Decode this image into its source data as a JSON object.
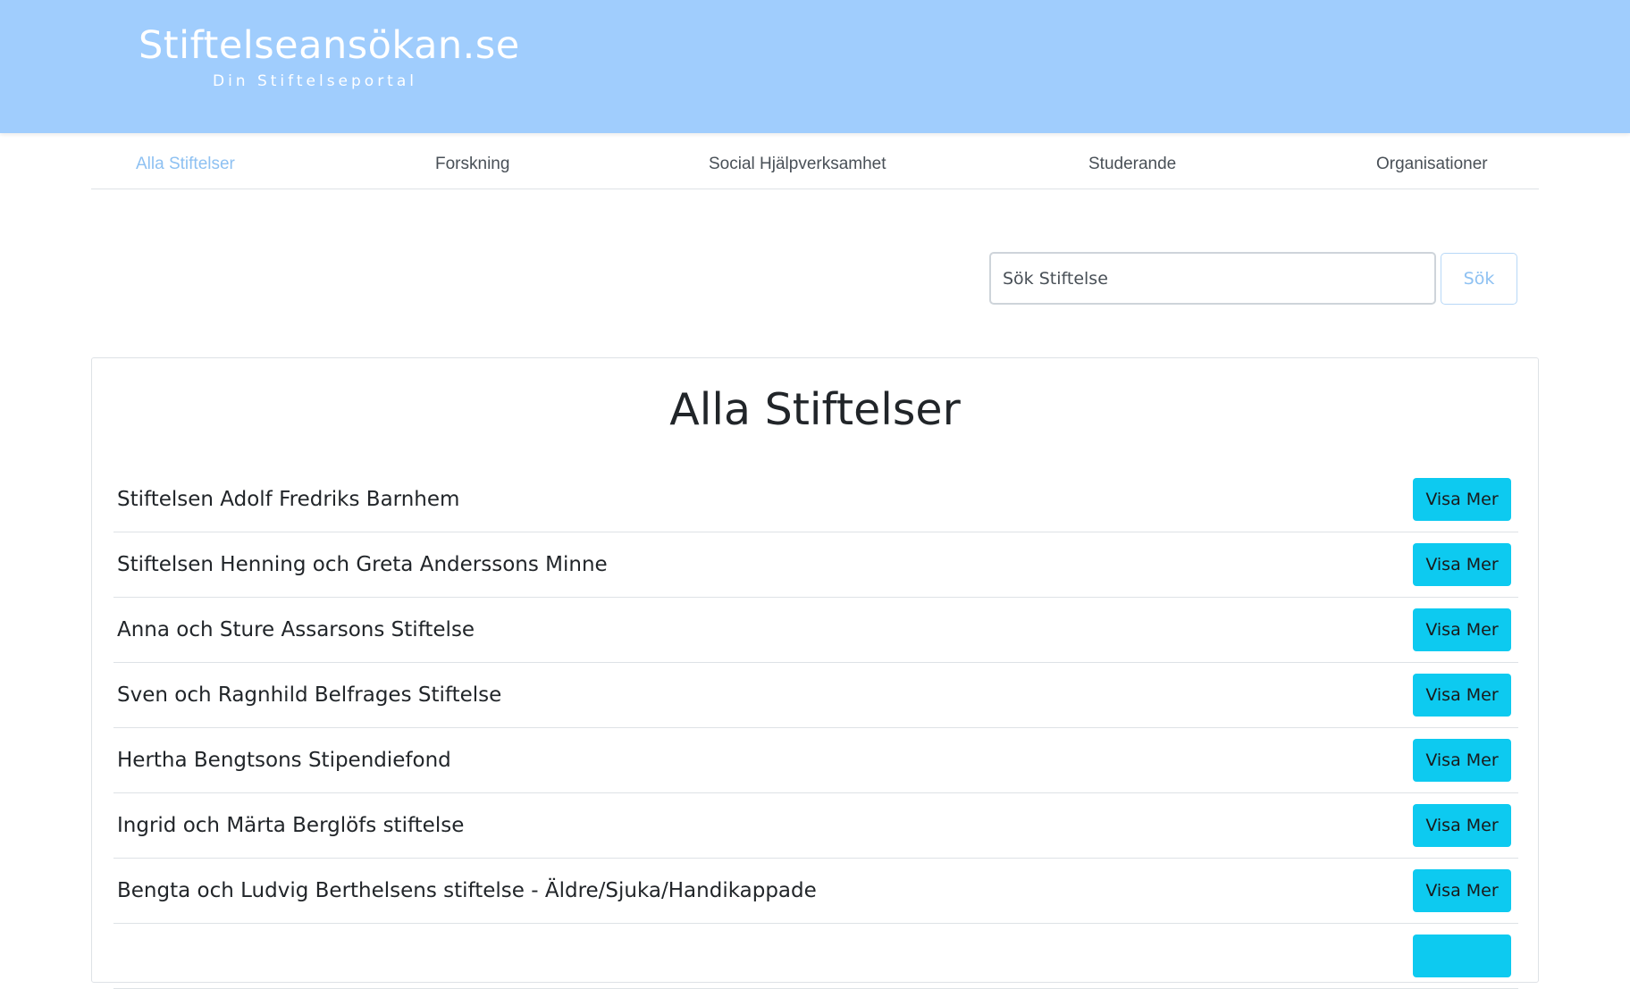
{
  "header": {
    "title": "Stiftelseansökan.se",
    "tagline": "Din Stiftelseportal",
    "background_color": "#a0cdfd"
  },
  "nav": {
    "items": [
      {
        "label": "Alla Stiftelser",
        "active": true
      },
      {
        "label": "Forskning",
        "active": false
      },
      {
        "label": "Social Hjälpverksamhet",
        "active": false
      },
      {
        "label": "Studerande",
        "active": false
      },
      {
        "label": "Organisationer",
        "active": false
      }
    ],
    "active_color": "#8ec1f2"
  },
  "search": {
    "placeholder": "Sök Stiftelse",
    "value": "",
    "button_label": "Sök"
  },
  "main": {
    "heading": "Alla Stiftelser",
    "foundations": [
      {
        "name": "Stiftelsen Adolf Fredriks Barnhem",
        "button_label": "Visa Mer"
      },
      {
        "name": "Stiftelsen Henning och Greta Anderssons Minne",
        "button_label": "Visa Mer"
      },
      {
        "name": "Anna och Sture Assarsons Stiftelse",
        "button_label": "Visa Mer"
      },
      {
        "name": "Sven och Ragnhild Belfrages Stiftelse",
        "button_label": "Visa Mer"
      },
      {
        "name": "Hertha Bengtsons Stipendiefond",
        "button_label": "Visa Mer"
      },
      {
        "name": "Ingrid och Märta Berglöfs stiftelse",
        "button_label": "Visa Mer"
      },
      {
        "name": "Bengta och Ludvig Berthelsens stiftelse - Äldre/Sjuka/Handikappade",
        "button_label": "Visa Mer"
      },
      {
        "name": "",
        "button_label": ""
      }
    ],
    "button_color": "#0dcaf0"
  }
}
